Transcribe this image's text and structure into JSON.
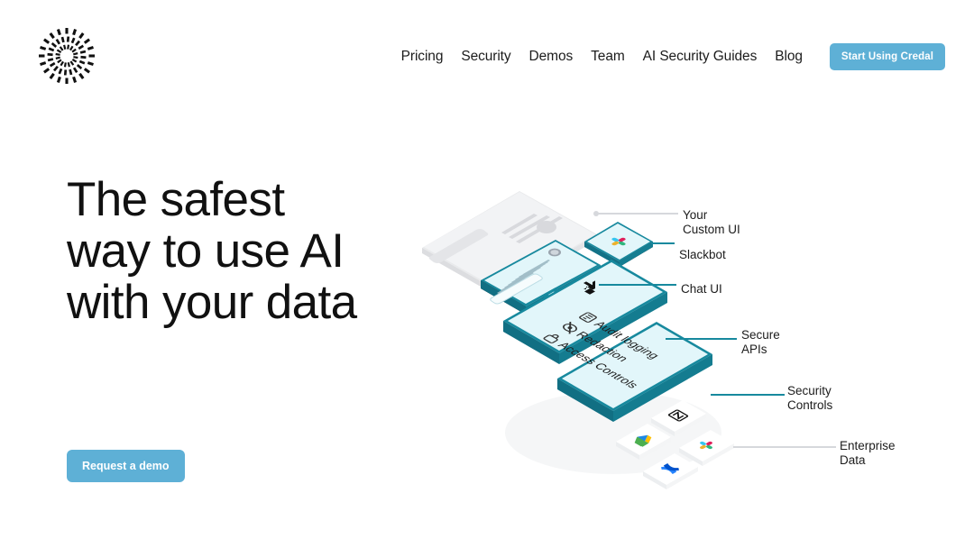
{
  "header": {
    "logo": {
      "icon": "credal-radial-burst-logo",
      "alt": "Credal logo"
    },
    "nav_items": [
      {
        "label": "Pricing",
        "name": "pricing"
      },
      {
        "label": "Security",
        "name": "security"
      },
      {
        "label": "Demos",
        "name": "demos"
      },
      {
        "label": "Team",
        "name": "team"
      },
      {
        "label": "AI Security Guides",
        "name": "ai-security-guides"
      },
      {
        "label": "Blog",
        "name": "blog"
      }
    ],
    "cta_label": "Start Using Credal"
  },
  "hero": {
    "title_lines": [
      "The safest",
      "way to use AI",
      "with your data"
    ],
    "demo_button_label": "Request a demo"
  },
  "illustration": {
    "labels": [
      {
        "text": "Your\nCustom UI",
        "name": "your-custom-ui",
        "connector": "grey"
      },
      {
        "text": "Slackbot",
        "name": "slackbot",
        "connector": "teal"
      },
      {
        "text": "Chat UI",
        "name": "chat-ui",
        "connector": "teal"
      },
      {
        "text": "Secure\nAPIs",
        "name": "secure-apis",
        "connector": "teal"
      },
      {
        "text": "Security\nControls",
        "name": "security-controls",
        "connector": "teal"
      },
      {
        "text": "Enterprise\nData",
        "name": "enterprise-data",
        "connector": "grey"
      }
    ],
    "security_controls_items": [
      "Audit logging",
      "Redaction",
      "Access Controls"
    ],
    "data_source_icons": [
      "google-drive-icon",
      "notion-icon",
      "confluence-icon",
      "slack-icon"
    ],
    "chat_card_icon": "robot-avatar-icon",
    "api_card_icon": "api-connector-icon"
  },
  "colors": {
    "accent_blue": "#5eb0d6",
    "accent_teal": "#17899e",
    "card_fill_teal": "#e2f6fa",
    "card_fill_grey": "#eff0f2",
    "text_dark": "#1c1c1c",
    "background": "#ffffff"
  }
}
